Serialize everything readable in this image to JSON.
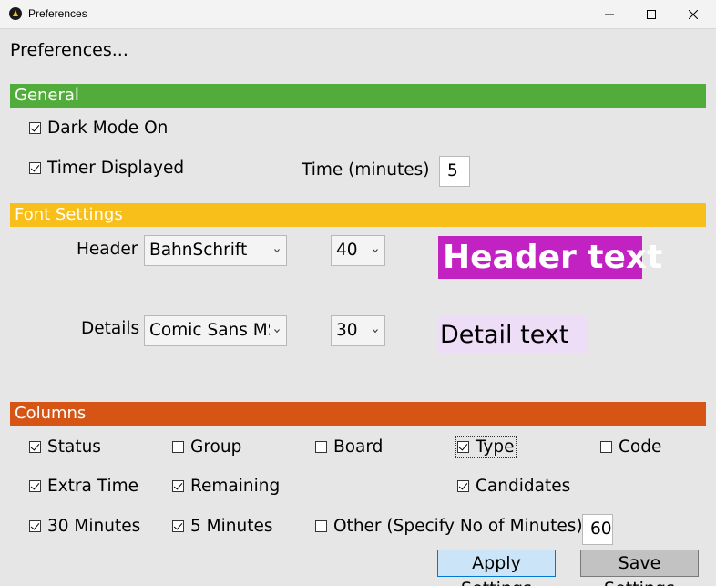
{
  "window": {
    "title": "Preferences",
    "icon": "app-logo-icon",
    "controls": [
      "minimize-icon",
      "maximize-icon",
      "close-icon"
    ]
  },
  "heading": "Preferences...",
  "colors": {
    "general_bar": "#52ac3c",
    "font_bar": "#f8be1a",
    "columns_bar": "#d65515",
    "header_preview_bg": "#c322c3",
    "detail_preview_bg": "#eeddf6",
    "apply_button_bg": "#cce4f7",
    "save_button_bg": "#c2c2c2"
  },
  "general": {
    "title": "General",
    "dark_mode": {
      "label": "Dark Mode On",
      "checked": true
    },
    "timer": {
      "label": "Timer Displayed",
      "checked": true
    },
    "time_label": "Time (minutes)",
    "time_value": "5"
  },
  "font_settings": {
    "title": "Font Settings",
    "header": {
      "label": "Header",
      "font": "BahnSchrift",
      "size": "40",
      "preview": "Header text"
    },
    "details": {
      "label": "Details",
      "font": "Comic Sans MS",
      "size": "30",
      "preview": "Detail text"
    }
  },
  "columns": {
    "title": "Columns",
    "items": [
      {
        "label": "Status",
        "checked": true
      },
      {
        "label": "Group",
        "checked": false
      },
      {
        "label": "Board",
        "checked": false
      },
      {
        "label": "Type",
        "checked": true
      },
      {
        "label": "Code",
        "checked": false
      },
      {
        "label": "Extra Time",
        "checked": true
      },
      {
        "label": "Remaining",
        "checked": true
      },
      {
        "label": "Candidates",
        "checked": true
      },
      {
        "label": "30 Minutes",
        "checked": true
      },
      {
        "label": "5 Minutes",
        "checked": true
      },
      {
        "label": "Other (Specify No of Minutes)",
        "checked": false
      }
    ],
    "other_value": "60"
  },
  "buttons": {
    "apply": "Apply Settings",
    "save": "Save Settings"
  }
}
